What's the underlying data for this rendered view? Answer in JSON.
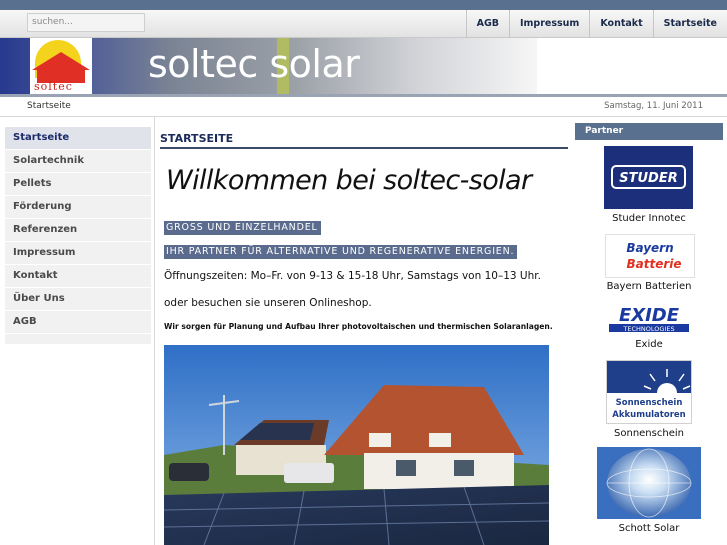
{
  "search": {
    "placeholder": "suchen..."
  },
  "top_nav": [
    "AGB",
    "Impressum",
    "Kontakt",
    "Startseite"
  ],
  "banner": {
    "logo_text": "soltec",
    "brand": "soltec solar"
  },
  "breadcrumb": "Startseite",
  "date": "Samstag, 11. Juni 2011",
  "sidebar": {
    "items": [
      {
        "label": "Startseite"
      },
      {
        "label": "Solartechnik"
      },
      {
        "label": "Pellets"
      },
      {
        "label": "Förderung"
      },
      {
        "label": "Referenzen"
      },
      {
        "label": "Impressum"
      },
      {
        "label": "Kontakt"
      },
      {
        "label": "Über Uns"
      },
      {
        "label": "AGB"
      }
    ]
  },
  "main": {
    "section_title": "STARTSEITE",
    "welcome": "Willkommen bei soltec-solar",
    "highlight_1": "GROSS UND EINZELHANDEL",
    "highlight_2": "IHR PARTNER FÜR ALTERNATIVE  UND  REGENERATIVE ENERGIEN.",
    "hours": "Öffnungszeiten: Mo–Fr. von 9-13 & 15-18 Uhr, Samstags von 10–13 Uhr.",
    "shop_line": "oder besuchen sie unseren Onlineshop.",
    "planning": "Wir sorgen für Planung und Aufbau Ihrer photovoltaischen und thermischen Solaranlagen."
  },
  "partners": {
    "title": "Partner",
    "items": [
      {
        "name": "Studer Innotec",
        "logo_text": "STUDER"
      },
      {
        "name": "Bayern Batterien",
        "logo_text": [
          "Bayern",
          "Batterie"
        ]
      },
      {
        "name": "Exide",
        "logo_text": [
          "EXIDE",
          "TECHNOLOGIES"
        ]
      },
      {
        "name": "Sonnenschein",
        "logo_text": [
          "Sonnenschein",
          "Akkumulatoren"
        ]
      },
      {
        "name": "Schott Solar"
      }
    ]
  },
  "colors": {
    "accent": "#59708f",
    "highlight": "#5a6b8e",
    "title": "#1a2a5a"
  }
}
